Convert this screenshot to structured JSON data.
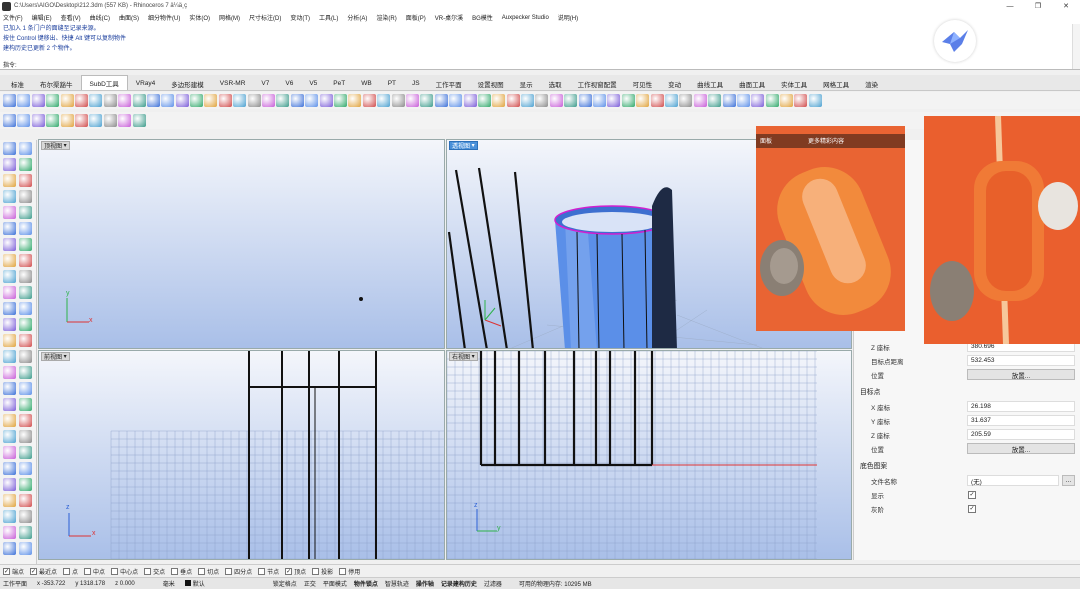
{
  "window": {
    "title": "C:\\Users\\AIGO\\Desktop\\212.3dm (557 KB) - Rhinoceros 7 ä¼ä¸ç"
  },
  "menu": [
    "文件(F)",
    "编辑(E)",
    "查看(V)",
    "曲线(C)",
    "曲面(S)",
    "细分物件(U)",
    "实体(O)",
    "网格(M)",
    "尺寸标注(D)",
    "变动(T)",
    "工具(L)",
    "分析(A)",
    "渲染(R)",
    "面板(P)",
    "VR-桌尔溪",
    "BG模性",
    "Auxpecker Studio",
    "说明(H)"
  ],
  "command_history": [
    "已加入 1 条门户的面缝至记录来源。",
    "按住 Control 键移出、快捷 Alt 键可以复制物件",
    "建构历史已更新 2 个物件。"
  ],
  "command_prompt": "指令:",
  "tabs": [
    "标准",
    "布尔渠豁牛",
    "SubD工具",
    "VRay4",
    "多边形建模",
    "VSR-MR",
    "V7",
    "V6",
    "V5",
    "PeT",
    "WB",
    "PT",
    "JS",
    "工作平面",
    "设置视图",
    "显示",
    "选取",
    "工作视窗配置",
    "可见性",
    "变动",
    "曲线工具",
    "曲面工具",
    "实体工具",
    "网格工具",
    "渲染"
  ],
  "active_tab_index": 2,
  "viewports": {
    "top": "顶视图",
    "perspective": "透视图",
    "front": "前视图",
    "right": "右视图"
  },
  "axis_labels": {
    "x": "x",
    "y": "y",
    "z": "z"
  },
  "properties": {
    "camera": [
      {
        "label": "Z 座标",
        "value": "380.696"
      },
      {
        "label": "目标点距离",
        "value": "532.453"
      }
    ],
    "camera_position_label": "位置",
    "place_button": "放置...",
    "target_header": "目标点",
    "target": [
      {
        "label": "X 座标",
        "value": "26.198"
      },
      {
        "label": "Y 座标",
        "value": "31.637"
      },
      {
        "label": "Z 座标",
        "value": "205.59"
      }
    ],
    "target_position_label": "位置",
    "target_place_button": "放置...",
    "wallpaper_header": "底色图案",
    "filename_label": "文件名称",
    "filename_value": "(无)",
    "browse_button": "...",
    "show_label": "显示",
    "gray_label": "灰阶",
    "show_checked": true,
    "gray_checked": true
  },
  "overlay": {
    "tag1": "面板",
    "tag2": "更多精彩内容"
  },
  "osnaps": [
    {
      "label": "端点",
      "checked": true
    },
    {
      "label": "最近点",
      "checked": true
    },
    {
      "label": "点",
      "checked": false
    },
    {
      "label": "中点",
      "checked": false
    },
    {
      "label": "中心点",
      "checked": false
    },
    {
      "label": "交点",
      "checked": false
    },
    {
      "label": "垂点",
      "checked": false
    },
    {
      "label": "切点",
      "checked": false
    },
    {
      "label": "四分点",
      "checked": false
    },
    {
      "label": "节点",
      "checked": false
    },
    {
      "label": "顶点",
      "checked": true
    },
    {
      "label": "投影",
      "checked": false
    },
    {
      "label": "停用",
      "checked": false
    }
  ],
  "status": {
    "cplane": "工作平面",
    "x": "x -353.722",
    "y": "y 1318.178",
    "z": "z 0.000",
    "units": "毫米",
    "layer": "默认",
    "items": [
      "锁定格点",
      "正交",
      "平面模式",
      "物件锁点",
      "智慧轨迹",
      "操作轴",
      "记录建构历史",
      "过滤器"
    ],
    "memory": "可用的物理内存: 10295 MB"
  },
  "colors": {
    "viewport_top": "#f4f6fb",
    "viewport_bottom": "#a9bfe8",
    "active_viewport": "#4a90d9",
    "photo_orange": "#e8572a",
    "cylinder_blue": "#5b8fe8",
    "edge_magenta": "#d020d0"
  }
}
